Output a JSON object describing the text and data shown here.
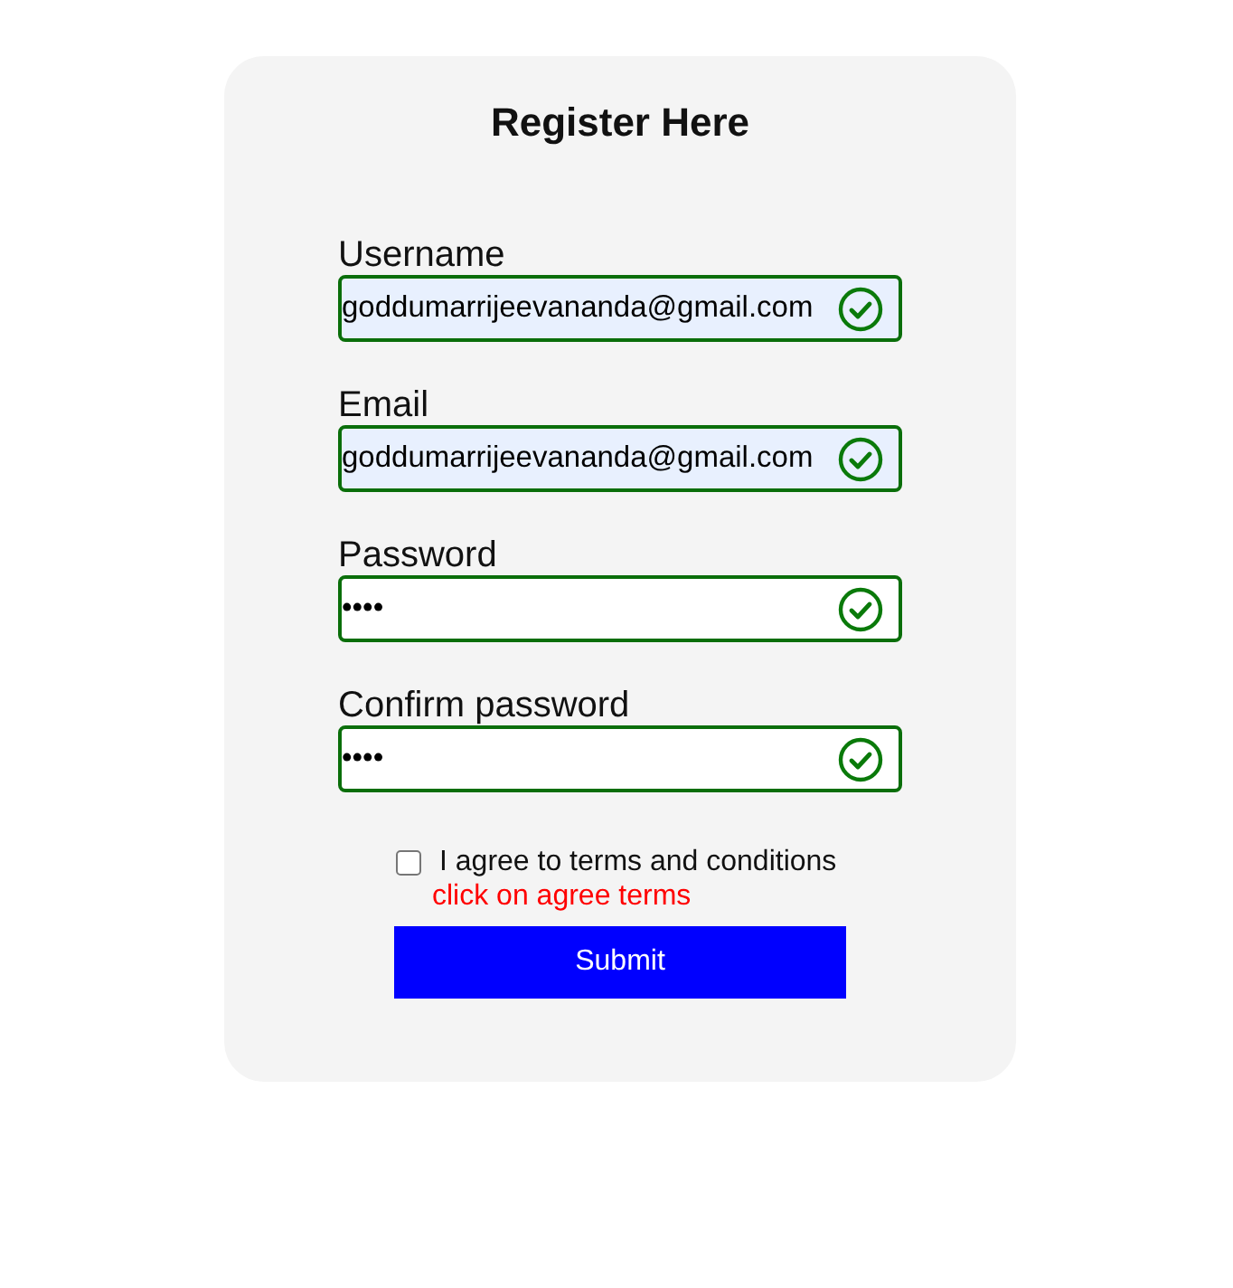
{
  "title": "Register Here",
  "fields": [
    {
      "label": "Username",
      "value": "goddumarrijeevananda@gmail.com",
      "autofilled": true,
      "valid": true
    },
    {
      "label": "Email",
      "value": "goddumarrijeevananda@gmail.com",
      "autofilled": true,
      "valid": true
    },
    {
      "label": "Password",
      "value": "••••",
      "autofilled": false,
      "valid": true
    },
    {
      "label": "Confirm password",
      "value": "••••",
      "autofilled": false,
      "valid": true
    }
  ],
  "agree": {
    "label": "I agree to terms and conditions",
    "checked": false,
    "error": "click on agree terms"
  },
  "submit": "Submit"
}
